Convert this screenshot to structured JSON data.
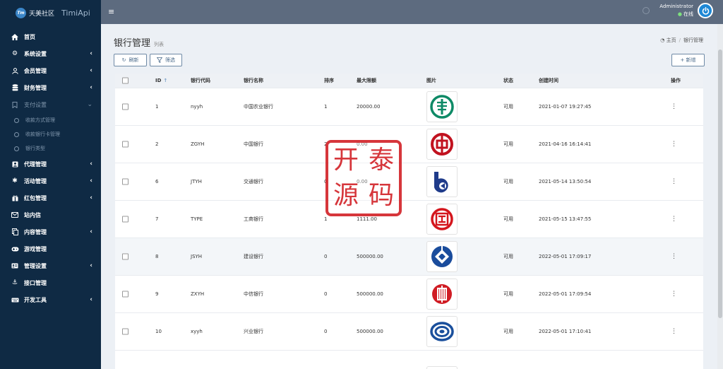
{
  "brand": {
    "logo_text": "Tm",
    "name": "天美社区",
    "sub": "TimiApi"
  },
  "sidebar": {
    "items": [
      {
        "label": "首页",
        "icon": "home-icon",
        "glyph": "⌂",
        "chevron": false
      },
      {
        "label": "系统设置",
        "icon": "cogs-icon",
        "glyph": "⚙",
        "chevron": true
      },
      {
        "label": "会员管理",
        "icon": "user-icon",
        "glyph": "👤",
        "chevron": true
      },
      {
        "label": "财务管理",
        "icon": "database-icon",
        "glyph": "≡",
        "chevron": true
      },
      {
        "label": "支付设置",
        "icon": "bookmark-icon",
        "glyph": "☐",
        "chevron": true,
        "expanded": true
      }
    ],
    "subitems": [
      {
        "label": "收款方式管理"
      },
      {
        "label": "收款银行卡管理"
      },
      {
        "label": "银行类型"
      }
    ],
    "items2": [
      {
        "label": "代理管理",
        "icon": "agent-icon",
        "glyph": "▣",
        "chevron": true
      },
      {
        "label": "活动管理",
        "icon": "activity-icon",
        "glyph": "✱",
        "chevron": true
      },
      {
        "label": "红包管理",
        "icon": "gift-icon",
        "glyph": "▦",
        "chevron": true
      },
      {
        "label": "站内信",
        "icon": "mail-icon",
        "glyph": "✉",
        "chevron": false
      },
      {
        "label": "内容管理",
        "icon": "copy-icon",
        "glyph": "❐",
        "chevron": true
      },
      {
        "label": "游戏管理",
        "icon": "gamepad-icon",
        "glyph": "◉",
        "chevron": false
      },
      {
        "label": "管理设置",
        "icon": "id-card-icon",
        "glyph": "▤",
        "chevron": true
      },
      {
        "label": "接口管理",
        "icon": "anchor-icon",
        "glyph": "⚓",
        "chevron": false
      },
      {
        "label": "开发工具",
        "icon": "keyboard-icon",
        "glyph": "⌨",
        "chevron": true
      }
    ]
  },
  "topbar": {
    "menu_icon": "≡",
    "user_name": "Administrator",
    "user_status": "在线",
    "power_glyph": "⏻"
  },
  "page": {
    "title": "银行管理",
    "subtitle": "列表",
    "breadcrumb_home": "主页",
    "breadcrumb_current": "银行管理"
  },
  "toolbar": {
    "refresh_label": "刷新",
    "filter_label": "筛选",
    "add_label": "+ 新增"
  },
  "table": {
    "headers": {
      "id": "ID",
      "code": "银行代码",
      "name": "银行名称",
      "sort": "排序",
      "max": "最大限额",
      "img": "图片",
      "status": "状态",
      "time": "创建时间",
      "op": "操作"
    },
    "rows": [
      {
        "id": "1",
        "code": "nyyh",
        "name": "中国农业银行",
        "sort": "1",
        "max": "20000.00",
        "status": "可用",
        "time": "2021-01-07 19:27:45",
        "logo": "abc-logo-icon"
      },
      {
        "id": "2",
        "code": "ZGYH",
        "name": "中国银行",
        "sort": "2",
        "max": "0.00",
        "status": "可用",
        "time": "2021-04-16 16:14:41",
        "logo": "boc-logo-icon"
      },
      {
        "id": "6",
        "code": "JTYH",
        "name": "交通银行",
        "sort": "0",
        "max": "0.00",
        "status": "可用",
        "time": "2021-05-14 13:50:54",
        "logo": "bocom-logo-icon"
      },
      {
        "id": "7",
        "code": "TYPE",
        "name": "工商银行",
        "sort": "1",
        "max": "1111.00",
        "status": "可用",
        "time": "2021-05-15 13:47:55",
        "logo": "icbc-logo-icon"
      },
      {
        "id": "8",
        "code": "JSYH",
        "name": "建设银行",
        "sort": "0",
        "max": "500000.00",
        "status": "可用",
        "time": "2022-05-01 17:09:17",
        "logo": "ccb-logo-icon"
      },
      {
        "id": "9",
        "code": "ZXYH",
        "name": "中信银行",
        "sort": "0",
        "max": "500000.00",
        "status": "可用",
        "time": "2022-05-01 17:09:54",
        "logo": "citic-logo-icon"
      },
      {
        "id": "10",
        "code": "xyyh",
        "name": "兴业银行",
        "sort": "0",
        "max": "500000.00",
        "status": "可用",
        "time": "2022-05-01 17:10:41",
        "logo": "cib-logo-icon"
      }
    ]
  },
  "watermark": {
    "chars": [
      "开",
      "泰",
      "源",
      "码"
    ]
  }
}
